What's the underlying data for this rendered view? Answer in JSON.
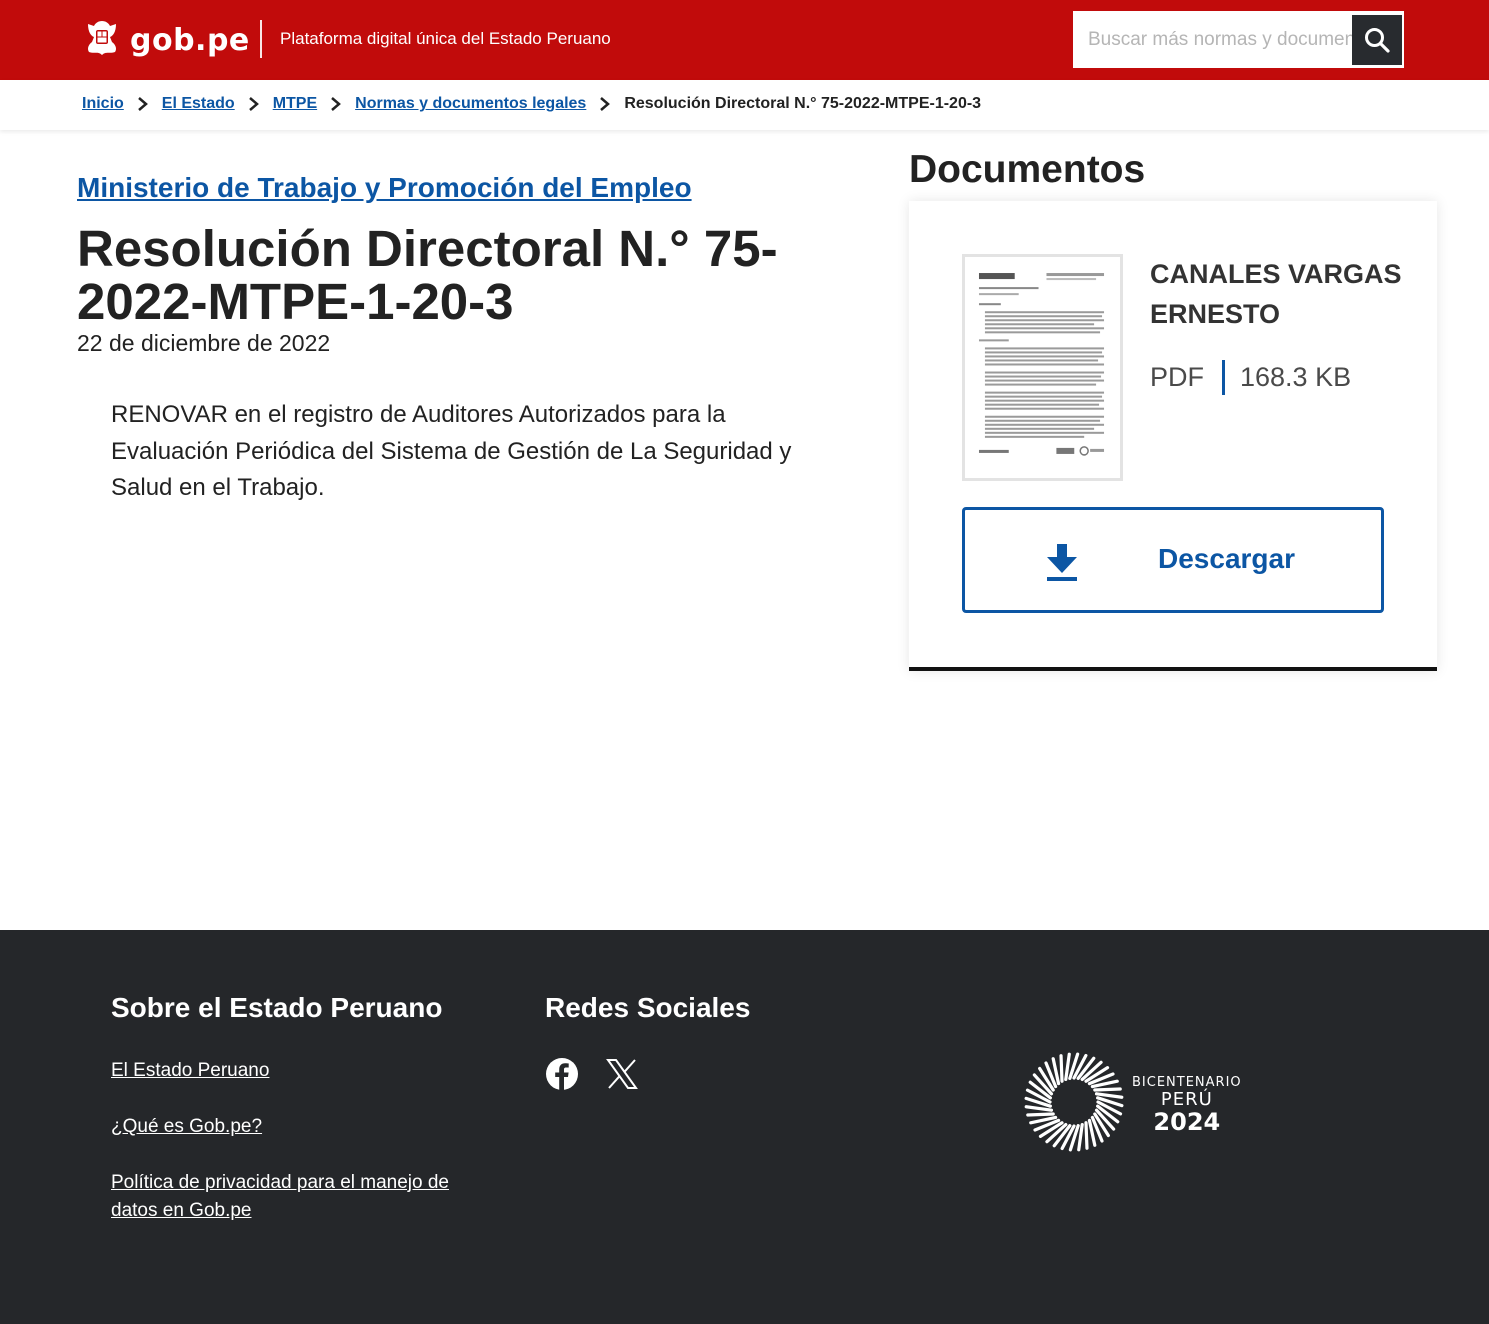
{
  "header": {
    "brand": "gob.pe",
    "tagline": "Plataforma digital única del Estado Peruano",
    "search_placeholder": "Buscar más normas y documentos",
    "colors": {
      "brand_red": "#c10b0b",
      "search_button": "#282b2f"
    }
  },
  "breadcrumb": {
    "items": [
      "Inicio",
      "El Estado",
      "MTPE",
      "Normas y documentos legales"
    ],
    "current": "Resolución Directoral N.° 75-2022-MTPE-1-20-3"
  },
  "main": {
    "agency": "Ministerio de Trabajo y Promoción del Empleo",
    "title": "Resolución Directoral N.° 75-2022-MTPE-1-20-3",
    "date": "22 de diciembre de 2022",
    "summary": "RENOVAR en el registro de Auditores Autorizados para la Evaluación Periódica del Sistema de Gestión de La Seguridad y Salud en el Trabajo.",
    "link_color": "#0c56a4"
  },
  "documents": {
    "heading": "Documentos",
    "items": [
      {
        "author": "CANALES VARGAS ERNESTO",
        "format": "PDF",
        "size": "168.3 KB",
        "download_label": "Descargar"
      }
    ]
  },
  "footer": {
    "about_heading": "Sobre el Estado Peruano",
    "links": [
      "El Estado Peruano",
      "¿Qué es Gob.pe?",
      "Política de privacidad para el manejo de datos en Gob.pe"
    ],
    "social_heading": "Redes Sociales",
    "social_icons": [
      "facebook-icon",
      "x-icon"
    ],
    "logo": {
      "line1": "BICENTENARIO",
      "line2": "PERÚ",
      "line3": "2024"
    },
    "background": "#25272a"
  }
}
